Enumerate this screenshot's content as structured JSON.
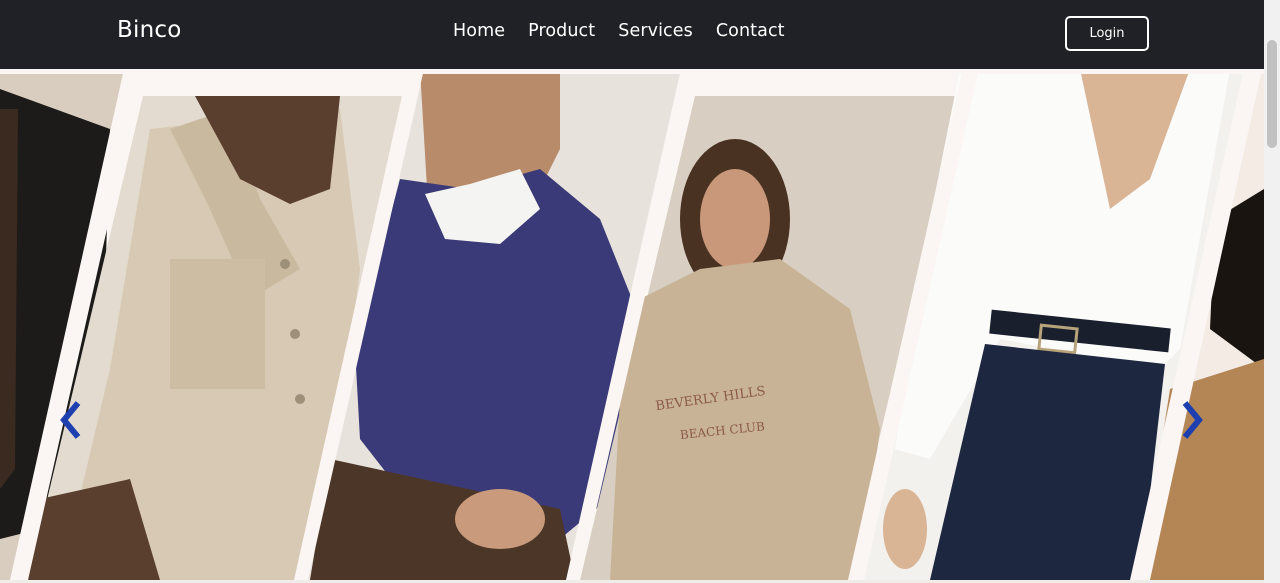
{
  "header": {
    "brand": "Binco",
    "menu": [
      {
        "label": "Home"
      },
      {
        "label": "Product"
      },
      {
        "label": "Services"
      },
      {
        "label": "Contact"
      }
    ],
    "login_label": "Login"
  },
  "carousel": {
    "prev_icon": "chevron-left-icon",
    "next_icon": "chevron-right-icon",
    "arrow_color": "#1e3fb0",
    "slides": [
      {
        "subject": "black blazer"
      },
      {
        "subject": "beige utility shirt"
      },
      {
        "subject": "navy cable knit sweater"
      },
      {
        "subject": "beige sweatshirt",
        "print_text": "BEVERLY HILLS BEACH CLUB"
      },
      {
        "subject": "white blouse with navy trousers"
      },
      {
        "subject": "tan knit top"
      }
    ]
  },
  "colors": {
    "nav_bg": "#1f2126",
    "text": "#ffffff",
    "frame": "#fbf6f3"
  }
}
